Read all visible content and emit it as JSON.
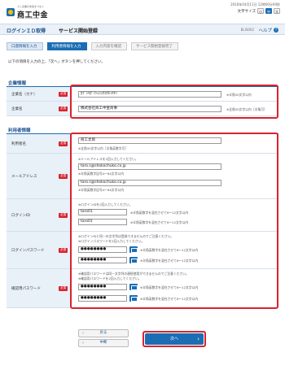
{
  "header": {
    "logo_sub": "人と企業の未来をつなぐ",
    "logo_name": "商工中金",
    "logo_en": "SHOKO CHUKIN BANK",
    "datetime": "2016年04月11日 12時00分00秒",
    "font_size_label": "文字サイズ",
    "font_size_options": [
      "小",
      "中",
      "大"
    ]
  },
  "titlebar": {
    "title_login": "ログインＩＤ取得",
    "title_page": "サービス開始登録",
    "screen_code": "BLIS002",
    "help_label": "ヘルプ"
  },
  "steps": [
    {
      "label": "口座情報を入力",
      "state": "done"
    },
    {
      "label": "利用者情報を入力",
      "state": "active"
    },
    {
      "label": "入力内容を確認",
      "state": "future"
    },
    {
      "label": "サービス開始登録完了",
      "state": "future"
    }
  ],
  "instruction": "以下の項目を入力の上、「次へ」ボタンを押してください。",
  "required_label": "必須",
  "company": {
    "section_title": "企業情報",
    "kana_label": "企業名（カナ）",
    "kana_value": "ｶﾌﾞｼｷｶﾞｲｼｬｼｮｳｺｳﾁｭｳｷﾝ",
    "kana_note": "※半角30文字以内",
    "name_label": "企業名",
    "name_value": "株式会社商工中金商事",
    "name_note": "※全角30文字以内［半角可］"
  },
  "user": {
    "section_title": "利用者情報",
    "username_label": "利用者名",
    "username_value": "商工太郎",
    "username_note": "※全角30文字以内［半角英数字可］",
    "email_label": "メールアドレス",
    "email_hint": "※メールアドレスを2回入力してください。",
    "email_value": "taro.s@shokochuko.co.jp",
    "email_note": "※半角英数字記号4〜64文字以内",
    "email_value2": "taro.s@shokochuko.co.jp",
    "email_note2": "※半角英数字記号4〜64文字以内",
    "loginid_label": "ログインID",
    "loginid_hint": "※ログインIDを2回入力してください。",
    "loginid_value": "taro01",
    "loginid_note": "※半角英数字を混在させて6〜12文字以内",
    "loginid_value2": "taro01",
    "loginid_note2": "※半角英数字を混在させて6〜12文字以内",
    "loginpw_label": "ログインパスワード",
    "loginpw_hint1": "※ログインIDと同一の文字列は登録できませんのでご注意ください。",
    "loginpw_hint2": "※ログインパスワードを2回入力してください。",
    "loginpw_value": "●●●●●●●●",
    "loginpw_note": "※半角英数字を混在させて6〜12文字以内",
    "loginpw_value2": "●●●●●●●●",
    "loginpw_note2": "※半角英数字を混在させて6〜12文字以内",
    "confirmpw_label": "確認用パスワード",
    "confirmpw_hint1": "※確認用パスワードは同一文字列の連続使用ができませんのでご注意ください。",
    "confirmpw_hint2": "※確認用パスワードを2回入力してください。",
    "confirmpw_value": "●●●●●●●●",
    "confirmpw_note": "※半角英数字を混在させて6〜12文字以内",
    "confirmpw_value2": "●●●●●●●●",
    "confirmpw_note2": "※半角英数字を混在させて6〜12文字以内"
  },
  "buttons": {
    "back": "戻る",
    "cancel": "中断",
    "next": "次へ"
  },
  "colors": {
    "primary": "#1b6db4",
    "highlight": "#d9232e",
    "label_bg": "#e8f0f8"
  }
}
